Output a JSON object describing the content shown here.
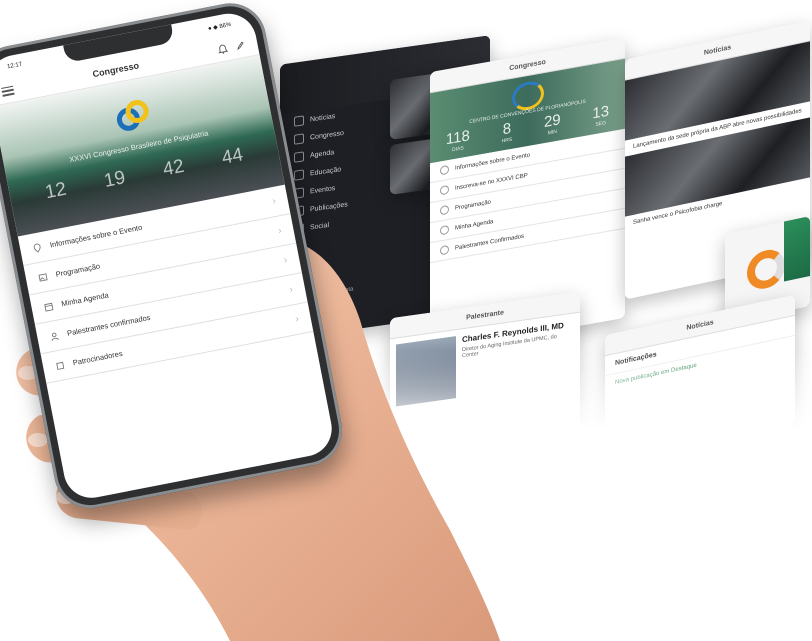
{
  "phone": {
    "status_time": "12:17",
    "status_right": "● ◆ 86%",
    "nav_title": "Congresso",
    "event_title": "XXXVI Congresso Brasileiro de Psiquiatria",
    "countdown": [
      "12",
      "19",
      "42",
      "44"
    ],
    "menu_items": [
      {
        "label": "Informações sobre o Evento",
        "icon": "pin-icon"
      },
      {
        "label": "Programação",
        "icon": "image-icon"
      },
      {
        "label": "Minha Agenda",
        "icon": "calendar-icon"
      },
      {
        "label": "Palestrantes confirmados",
        "icon": "person-icon"
      },
      {
        "label": "Patrocinadores",
        "icon": "box-icon"
      }
    ]
  },
  "screens": {
    "sidebar_items": [
      "Notícias",
      "Congresso",
      "Agenda",
      "Educação",
      "Eventos",
      "Publicações",
      "Social"
    ],
    "sidebar_footer": "Sair desta conta",
    "main_nav_title": "Congresso",
    "main_countdown": [
      "118",
      "8",
      "29",
      "13"
    ],
    "main_countdown_units": [
      "DIAS",
      "HRS",
      "MIN",
      "SEG"
    ],
    "main_banner_text": "CENTRO DE CONVENÇÕES DE FLORIANÓPOLIS",
    "main_menu": [
      "Informações sobre o Evento",
      "Inscreva-se no XXXVI CBP",
      "Programação",
      "Minha Agenda",
      "Palestrantes Confirmados"
    ],
    "speaker_title": "Palestrante",
    "speaker_name": "Charles F. Reynolds III, MD",
    "speaker_text": "Diretor do Aging Institute da UPMC, do Center",
    "notif_title": "Notícias",
    "notif_subtitle": "Notificações",
    "notif_item": "Nova publicação em Destaque",
    "news_text_1": "Lançamento da sede própria da ABP abre novas possibilidades",
    "news_text_2": "Sanha vence o Psicofobia charge"
  }
}
